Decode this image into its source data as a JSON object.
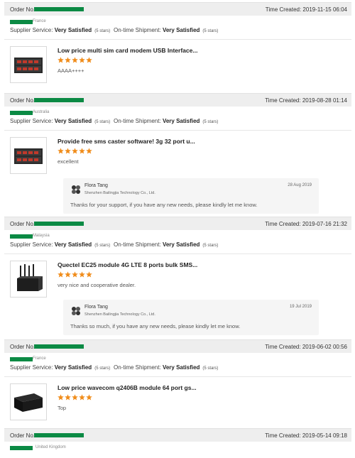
{
  "labels": {
    "order_no": "Order No.:",
    "time_created": "Time Created:",
    "supplier_service": "Supplier Service:",
    "on_time_shipment": "On-time Shipment:"
  },
  "colors": {
    "star": "#f08c1a",
    "redaction": "#0b8a44"
  },
  "reviews": [
    {
      "time": "2019-11-15 06:04",
      "country": "France",
      "supplier_service": "Very Satisfied",
      "supplier_stars": "(5 stars)",
      "shipment": "Very Satisfied",
      "shipment_stars": "(5 stars)",
      "product_title": "Low price multi sim card modem USB Interface...",
      "product_icon": "multi-sim-modem-pool-image",
      "rating": 5,
      "comment": "AAAA++++",
      "reply": null
    },
    {
      "time": "2019-08-28 01:14",
      "country": "Australia",
      "supplier_service": "Very Satisfied",
      "supplier_stars": "(5 stars)",
      "shipment": "Very Satisfied",
      "shipment_stars": "(5 stars)",
      "product_title": "Provide free sms caster software! 3g 32 port u...",
      "product_icon": "multi-sim-modem-pool-image",
      "rating": 5,
      "comment": "excellent",
      "reply": {
        "name": "Flora Tang",
        "company": "Shenzhen Bailingjia Technology Co., Ltd.",
        "date": "28 Aug 2019",
        "text": "Thanks for your support, if you have any new needs, please kindly let me know."
      }
    },
    {
      "time": "2019-07-16 21:32",
      "country": "Malaysia",
      "supplier_service": "Very Satisfied",
      "supplier_stars": "(5 stars)",
      "shipment": "Very Satisfied",
      "shipment_stars": "(5 stars)",
      "product_title": "Quectel EC25 module 4G LTE 8 ports bulk SMS...",
      "product_icon": "lte-gateway-antennas-image",
      "rating": 5,
      "comment": "very nice and cooperative dealer.",
      "reply": {
        "name": "Flora Tang",
        "company": "Shenzhen Bailingjia Technology Co., Ltd.",
        "date": "19 Jul 2019",
        "text": "Thanks so much, if you have any new needs, please kindly let me know."
      }
    },
    {
      "time": "2019-06-02 00:56",
      "country": "France",
      "supplier_service": "Very Satisfied",
      "supplier_stars": "(5 stars)",
      "shipment": "Very Satisfied",
      "shipment_stars": "(5 stars)",
      "product_title": "Low price wavecom q2406B module 64 port gs...",
      "product_icon": "black-modem-box-image",
      "rating": 5,
      "comment": "Top",
      "reply": null
    },
    {
      "time": "2019-05-14 09:18",
      "country": "United Kingdom"
    }
  ]
}
